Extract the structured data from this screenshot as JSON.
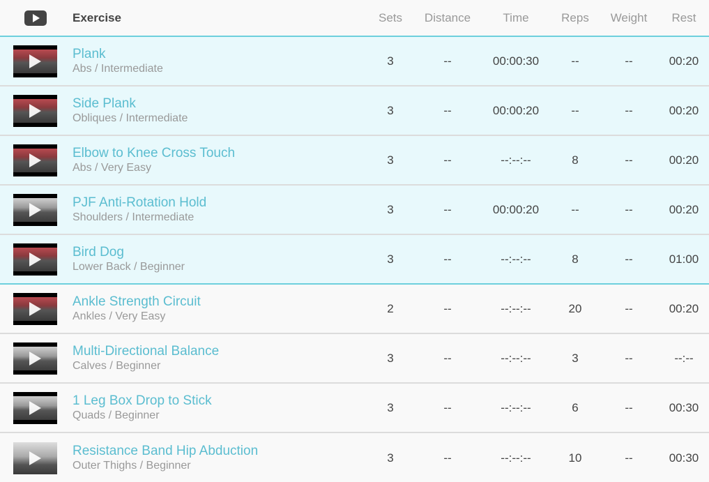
{
  "header": {
    "exercise": "Exercise",
    "sets": "Sets",
    "distance": "Distance",
    "time": "Time",
    "reps": "Reps",
    "weight": "Weight",
    "rest": "Rest",
    "video_icon": "video-play-icon"
  },
  "colors": {
    "accent": "#5bbdd0",
    "highlight_row": "#e8f9fc",
    "highlight_border": "#6dd0dd"
  },
  "rows": [
    {
      "name": "Plank",
      "sub": "Abs / Intermediate",
      "sets": "3",
      "distance": "--",
      "time": "00:00:30",
      "reps": "--",
      "weight": "--",
      "rest": "00:20",
      "highlighted": true
    },
    {
      "name": "Side Plank",
      "sub": "Obliques / Intermediate",
      "sets": "3",
      "distance": "--",
      "time": "00:00:20",
      "reps": "--",
      "weight": "--",
      "rest": "00:20",
      "highlighted": true
    },
    {
      "name": "Elbow to Knee Cross Touch",
      "sub": "Abs / Very Easy",
      "sets": "3",
      "distance": "--",
      "time": "--:--:--",
      "reps": "8",
      "weight": "--",
      "rest": "00:20",
      "highlighted": true
    },
    {
      "name": "PJF Anti-Rotation Hold",
      "sub": "Shoulders / Intermediate",
      "sets": "3",
      "distance": "--",
      "time": "00:00:20",
      "reps": "--",
      "weight": "--",
      "rest": "00:20",
      "highlighted": true
    },
    {
      "name": "Bird Dog",
      "sub": "Lower Back / Beginner",
      "sets": "3",
      "distance": "--",
      "time": "--:--:--",
      "reps": "8",
      "weight": "--",
      "rest": "01:00",
      "highlighted": true
    },
    {
      "name": "Ankle Strength Circuit",
      "sub": "Ankles / Very Easy",
      "sets": "2",
      "distance": "--",
      "time": "--:--:--",
      "reps": "20",
      "weight": "--",
      "rest": "00:20",
      "highlighted": false
    },
    {
      "name": "Multi-Directional Balance",
      "sub": "Calves / Beginner",
      "sets": "3",
      "distance": "--",
      "time": "--:--:--",
      "reps": "3",
      "weight": "--",
      "rest": "--:--",
      "highlighted": false
    },
    {
      "name": "1 Leg Box Drop to Stick",
      "sub": "Quads / Beginner",
      "sets": "3",
      "distance": "--",
      "time": "--:--:--",
      "reps": "6",
      "weight": "--",
      "rest": "00:30",
      "highlighted": false
    },
    {
      "name": "Resistance Band Hip Abduction",
      "sub": "Outer Thighs / Beginner",
      "sets": "3",
      "distance": "--",
      "time": "--:--:--",
      "reps": "10",
      "weight": "--",
      "rest": "00:30",
      "highlighted": false
    }
  ]
}
